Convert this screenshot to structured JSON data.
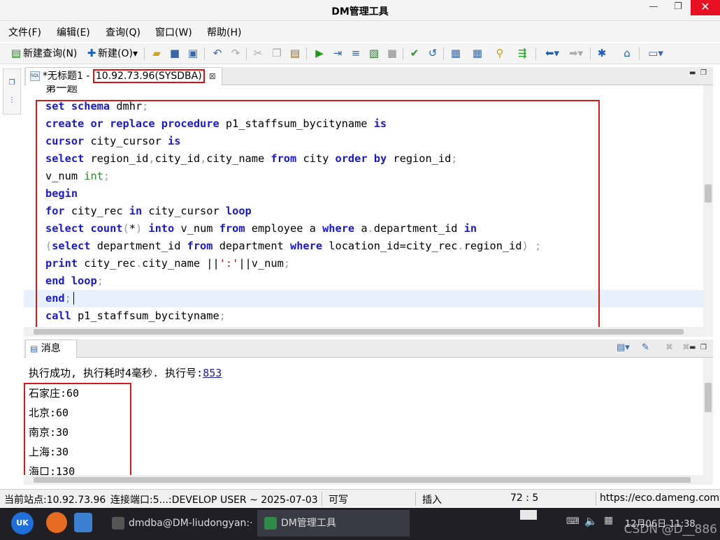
{
  "window": {
    "title": "DM管理工具",
    "min": "—",
    "restore": "❐",
    "close": "✕"
  },
  "menu": [
    "文件(F)",
    "编辑(E)",
    "查询(Q)",
    "窗口(W)",
    "帮助(H)"
  ],
  "toolbar": {
    "new_query": "新建查询(N)",
    "new": "新建(O)▾"
  },
  "editor_tab": {
    "title": "*无标题1 - ",
    "connection": "10.92.73.96(SYSDBA)",
    "close": "⊠"
  },
  "editor": {
    "partial_top": "第一题",
    "lines": [
      "set schema dmhr;",
      "create or replace procedure p1_staffsum_bycityname is",
      "cursor city_cursor is",
      "select region_id,city_id,city_name from city order by region_id;",
      "v_num int;",
      "begin",
      "for city_rec in city_cursor loop",
      "select count(*) into v_num from employee a where a.department_id in",
      "(select department_id from department where location_id=city_rec.region_id) ;",
      "print city_rec.city_name ||':'||v_num;",
      "end loop;",
      "end;",
      "call p1_staffsum_bycityname;"
    ]
  },
  "messages": {
    "tab_label": "消息",
    "status_prefix": "执行成功, 执行耗时4毫秒. 执行号:",
    "exec_no": "853",
    "results": [
      "石家庄:60",
      "北京:60",
      "南京:30",
      "上海:30",
      "海口:130"
    ]
  },
  "statusbar": {
    "site": "当前站点:10.92.73.96",
    "port": "连接端口:5...:DEVELOP USER ~ 2025-07-03",
    "writable": "可写",
    "mode": "插入",
    "position": "72 : 5",
    "url": "https://eco.dameng.com"
  },
  "taskbar": {
    "terminal": "dmdba@DM-liudongyan:···",
    "app": "DM管理工具",
    "clock": "12月06日 11:38",
    "watermark": "CSDN @D__886"
  },
  "colors": {
    "keyword": "#1a1acd",
    "type": "#2a8a2a",
    "string": "#d01010",
    "highlight_box": "#d21c1c"
  }
}
